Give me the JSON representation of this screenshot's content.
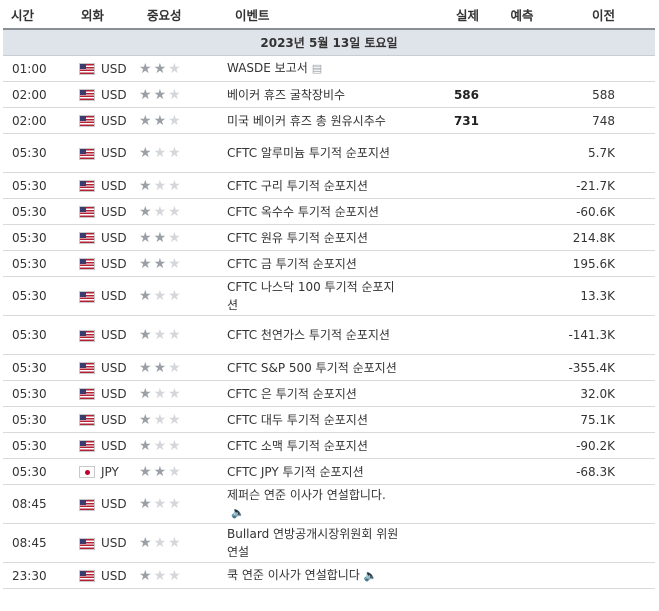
{
  "headers": {
    "time": "시간",
    "currency": "외화",
    "importance": "중요성",
    "event": "이벤트",
    "actual": "실제",
    "forecast": "예측",
    "previous": "이전"
  },
  "date_label": "2023년 5월 13일 토요일",
  "events": [
    {
      "time": "01:00",
      "currency": "USD",
      "flag": "us",
      "stars": 2,
      "event": "WASDE 보고서",
      "icon": "document-icon",
      "actual": "",
      "forecast": "",
      "previous": ""
    },
    {
      "time": "02:00",
      "currency": "USD",
      "flag": "us",
      "stars": 2,
      "event": "베이커 휴즈 굴착장비수",
      "icon": "",
      "actual": "586",
      "forecast": "",
      "previous": "588"
    },
    {
      "time": "02:00",
      "currency": "USD",
      "flag": "us",
      "stars": 2,
      "event": "미국 베이커 휴즈 총 원유시추수",
      "icon": "",
      "actual": "731",
      "forecast": "",
      "previous": "748"
    },
    {
      "time": "05:30",
      "currency": "USD",
      "flag": "us",
      "stars": 1,
      "event": "CFTC 알루미늄 투기적 순포지션",
      "icon": "",
      "actual": "",
      "forecast": "",
      "previous": "5.7K",
      "tall": true
    },
    {
      "time": "05:30",
      "currency": "USD",
      "flag": "us",
      "stars": 1,
      "event": "CFTC 구리 투기적 순포지션",
      "icon": "",
      "actual": "",
      "forecast": "",
      "previous": "-21.7K"
    },
    {
      "time": "05:30",
      "currency": "USD",
      "flag": "us",
      "stars": 1,
      "event": "CFTC 옥수수 투기적 순포지션",
      "icon": "",
      "actual": "",
      "forecast": "",
      "previous": "-60.6K"
    },
    {
      "time": "05:30",
      "currency": "USD",
      "flag": "us",
      "stars": 2,
      "event": "CFTC 원유 투기적 순포지션",
      "icon": "",
      "actual": "",
      "forecast": "",
      "previous": "214.8K"
    },
    {
      "time": "05:30",
      "currency": "USD",
      "flag": "us",
      "stars": 2,
      "event": "CFTC 금 투기적 순포지션",
      "icon": "",
      "actual": "",
      "forecast": "",
      "previous": "195.6K"
    },
    {
      "time": "05:30",
      "currency": "USD",
      "flag": "us",
      "stars": 1,
      "event": "CFTC 나스닥 100 투기적 순포지션",
      "icon": "",
      "actual": "",
      "forecast": "",
      "previous": "13.3K",
      "tall": true
    },
    {
      "time": "05:30",
      "currency": "USD",
      "flag": "us",
      "stars": 1,
      "event": "CFTC 천연가스 투기적 순포지션",
      "icon": "",
      "actual": "",
      "forecast": "",
      "previous": "-141.3K",
      "tall": true
    },
    {
      "time": "05:30",
      "currency": "USD",
      "flag": "us",
      "stars": 2,
      "event": "CFTC S&P 500 투기적 순포지션",
      "icon": "",
      "actual": "",
      "forecast": "",
      "previous": "-355.4K"
    },
    {
      "time": "05:30",
      "currency": "USD",
      "flag": "us",
      "stars": 1,
      "event": "CFTC 은 투기적 순포지션",
      "icon": "",
      "actual": "",
      "forecast": "",
      "previous": "32.0K"
    },
    {
      "time": "05:30",
      "currency": "USD",
      "flag": "us",
      "stars": 1,
      "event": "CFTC 대두 투기적 순포지션",
      "icon": "",
      "actual": "",
      "forecast": "",
      "previous": "75.1K"
    },
    {
      "time": "05:30",
      "currency": "USD",
      "flag": "us",
      "stars": 1,
      "event": "CFTC 소맥 투기적 순포지션",
      "icon": "",
      "actual": "",
      "forecast": "",
      "previous": "-90.2K"
    },
    {
      "time": "05:30",
      "currency": "JPY",
      "flag": "jp",
      "stars": 2,
      "event": "CFTC JPY 투기적 순포지션",
      "icon": "",
      "actual": "",
      "forecast": "",
      "previous": "-68.3K"
    },
    {
      "time": "08:45",
      "currency": "USD",
      "flag": "us",
      "stars": 1,
      "event": "제퍼슨 연준 이사가 연설합니다.",
      "icon": "speaker-icon",
      "icon_block": true,
      "actual": "",
      "forecast": "",
      "previous": "",
      "tall": true
    },
    {
      "time": "08:45",
      "currency": "USD",
      "flag": "us",
      "stars": 1,
      "event": "Bullard 연방공개시장위원회 위원 연설",
      "icon": "",
      "actual": "",
      "forecast": "",
      "previous": "",
      "tall": true
    },
    {
      "time": "23:30",
      "currency": "USD",
      "flag": "us",
      "stars": 1,
      "event": "쿡 연준 이사가 연설합니다",
      "icon": "speaker-icon",
      "actual": "",
      "forecast": "",
      "previous": ""
    }
  ]
}
